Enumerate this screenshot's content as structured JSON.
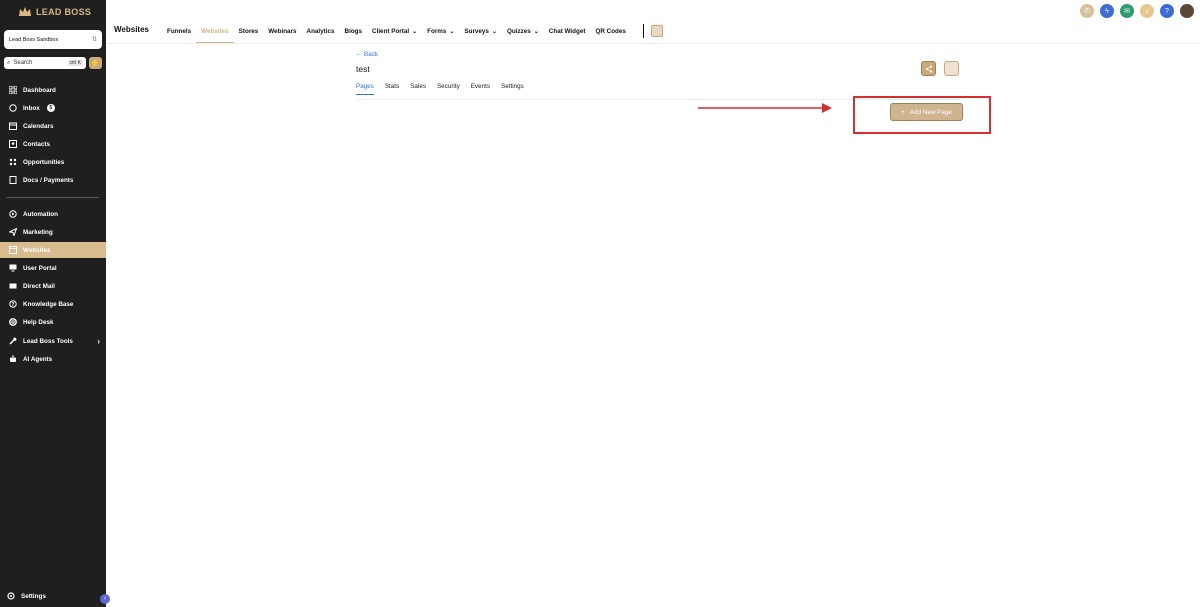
{
  "brand": {
    "name": "LEAD BOSS"
  },
  "account": {
    "name": "Lead Boss Sandbox"
  },
  "search": {
    "placeholder": "Search",
    "shortcut": "ctrl K"
  },
  "sidebar": {
    "items": [
      {
        "label": "Dashboard",
        "icon": "grid-icon"
      },
      {
        "label": "Inbox",
        "icon": "chat-icon",
        "badge": "5"
      },
      {
        "label": "Calendars",
        "icon": "calendar-icon"
      },
      {
        "label": "Contacts",
        "icon": "contacts-icon"
      },
      {
        "label": "Opportunities",
        "icon": "pipeline-icon"
      },
      {
        "label": "Docs / Payments",
        "icon": "document-icon"
      },
      {
        "label": "Automation",
        "icon": "automation-icon"
      },
      {
        "label": "Marketing",
        "icon": "send-icon"
      },
      {
        "label": "Websites",
        "icon": "website-icon",
        "active": true
      },
      {
        "label": "User Portal",
        "icon": "monitor-icon"
      },
      {
        "label": "Direct Mail",
        "icon": "mail-icon"
      },
      {
        "label": "Knowledge Base",
        "icon": "help-circle-icon"
      },
      {
        "label": "Help Desk",
        "icon": "lifebuoy-icon"
      },
      {
        "label": "Lead Boss Tools",
        "icon": "wrench-icon"
      },
      {
        "label": "AI Agents",
        "icon": "robot-icon"
      }
    ],
    "settings_label": "Settings"
  },
  "topnav": {
    "section": "Websites",
    "tabs": [
      {
        "label": "Funnels"
      },
      {
        "label": "Websites",
        "active": true
      },
      {
        "label": "Stores"
      },
      {
        "label": "Webinars"
      },
      {
        "label": "Analytics"
      },
      {
        "label": "Blogs"
      },
      {
        "label": "Client Portal",
        "dropdown": true
      },
      {
        "label": "Forms",
        "dropdown": true
      },
      {
        "label": "Surveys",
        "dropdown": true
      },
      {
        "label": "Quizzes",
        "dropdown": true
      },
      {
        "label": "Chat Widget"
      },
      {
        "label": "QR Codes"
      }
    ]
  },
  "header_icons": [
    "phone-icon",
    "lightning-icon",
    "megaphone-icon",
    "bell-icon",
    "help-icon",
    "avatar"
  ],
  "page": {
    "back": "← Back",
    "name": "test",
    "tabs": [
      "Pages",
      "Stats",
      "Sales",
      "Security",
      "Events",
      "Settings"
    ],
    "active_tab": "Pages",
    "add_button": "Add New Page"
  },
  "colors": {
    "accent": "#d2b58a",
    "sidebar_bg": "#1f1f1f",
    "link": "#3b6fd0",
    "highlight": "#d62f2f"
  }
}
